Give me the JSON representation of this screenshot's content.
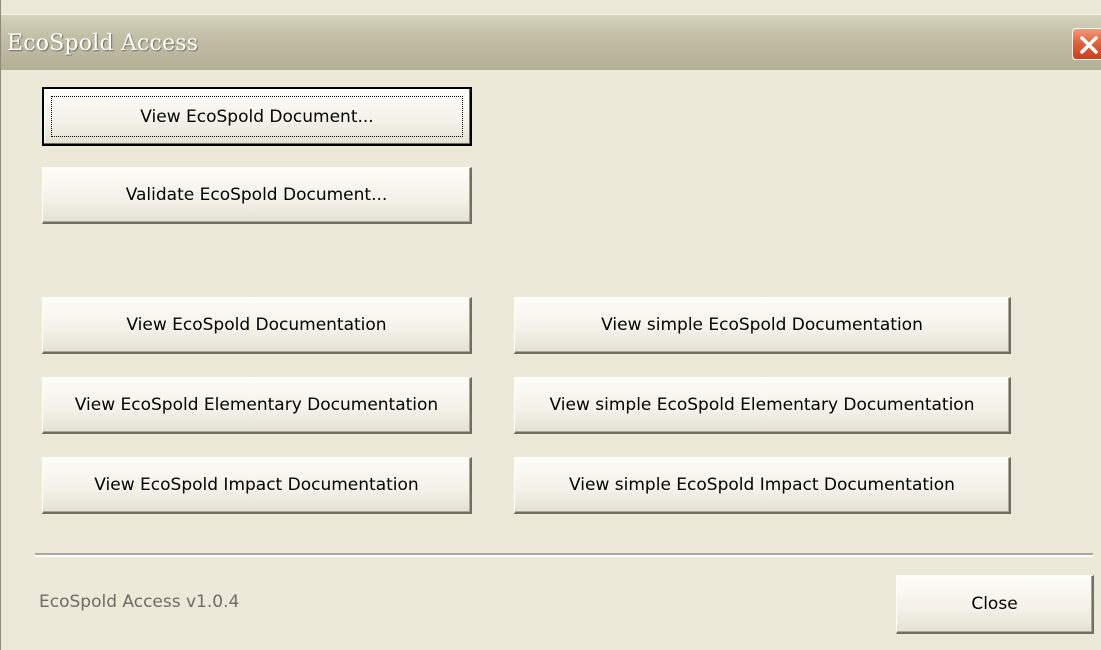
{
  "window": {
    "title": "EcoSpold Access"
  },
  "buttons": {
    "view_document": "View EcoSpold Document...",
    "validate_document": "Validate EcoSpold Document...",
    "view_documentation": "View EcoSpold Documentation",
    "view_elementary_documentation": "View EcoSpold Elementary Documentation",
    "view_impact_documentation": "View EcoSpold Impact Documentation",
    "view_simple_documentation": "View simple EcoSpold Documentation",
    "view_simple_elementary_documentation": "View simple EcoSpold Elementary Documentation",
    "view_simple_impact_documentation": "View simple EcoSpold Impact Documentation",
    "close": "Close"
  },
  "footer": {
    "version_label": "EcoSpold Access v1.0.4"
  },
  "colors": {
    "dialog_background": "#ece9d8",
    "close_button_red": "#e2623d"
  },
  "icons": {
    "title_close": "close-icon"
  }
}
